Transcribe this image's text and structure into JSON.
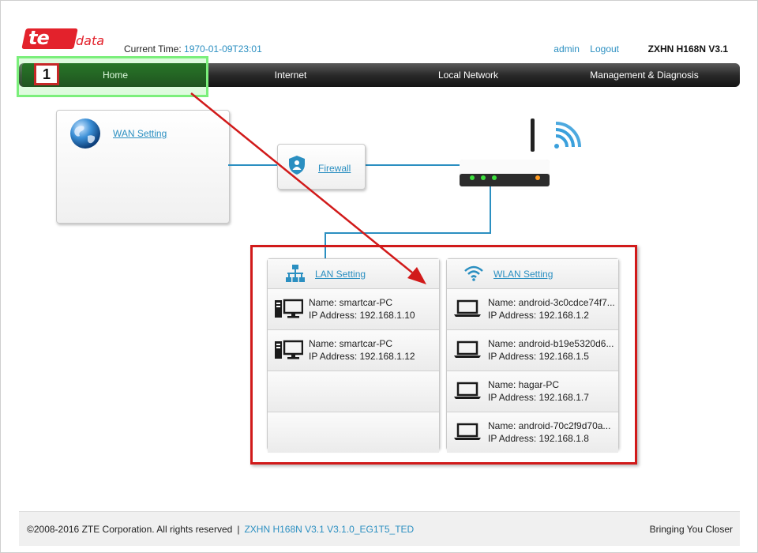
{
  "brand": {
    "logo_te": "te",
    "logo_data": "data"
  },
  "header": {
    "current_time_label": "Current Time:",
    "current_time_value": "1970-01-09T23:01",
    "user_link": "admin",
    "logout_link": "Logout",
    "model": "ZXHN H168N V3.1"
  },
  "nav": {
    "items": [
      {
        "label": "Home"
      },
      {
        "label": "Internet"
      },
      {
        "label": "Local Network"
      },
      {
        "label": "Management & Diagnosis"
      }
    ]
  },
  "annotation": {
    "step_number": "1",
    "highlight_color": "#7bef7b",
    "box_color": "#d11a1a",
    "arrow_color": "#d11a1a"
  },
  "topology": {
    "wan_setting": "WAN Setting",
    "firewall": "Firewall",
    "icons": {
      "wan": "globe-icon",
      "firewall": "shield-icon",
      "router": "router-icon",
      "wifi": "wifi-signal-icon"
    }
  },
  "lan": {
    "title": "LAN Setting",
    "devices": [
      {
        "name": "Name: smartcar-PC",
        "ip": "IP Address: 192.168.1.10"
      },
      {
        "name": "Name: smartcar-PC",
        "ip": "IP Address: 192.168.1.12"
      }
    ]
  },
  "wlan": {
    "title": "WLAN Setting",
    "devices": [
      {
        "name": "Name: android-3c0cdce74f7...",
        "ip": "IP Address: 192.168.1.2"
      },
      {
        "name": "Name: android-b19e5320d6...",
        "ip": "IP Address: 192.168.1.5"
      },
      {
        "name": "Name: hagar-PC",
        "ip": "IP Address: 192.168.1.7"
      },
      {
        "name": "Name: android-70c2f9d70a...",
        "ip": "IP Address: 192.168.1.8"
      }
    ]
  },
  "footer": {
    "copyright": "©2008-2016 ZTE Corporation. All rights reserved",
    "separator": "|",
    "version": "ZXHN H168N V3.1 V3.1.0_EG1T5_TED",
    "slogan": "Bringing You Closer"
  },
  "colors": {
    "link": "#2b8fc1",
    "brand_red": "#e3222c",
    "nav_dark": "#2a2a2a",
    "home_green": "#063306"
  }
}
